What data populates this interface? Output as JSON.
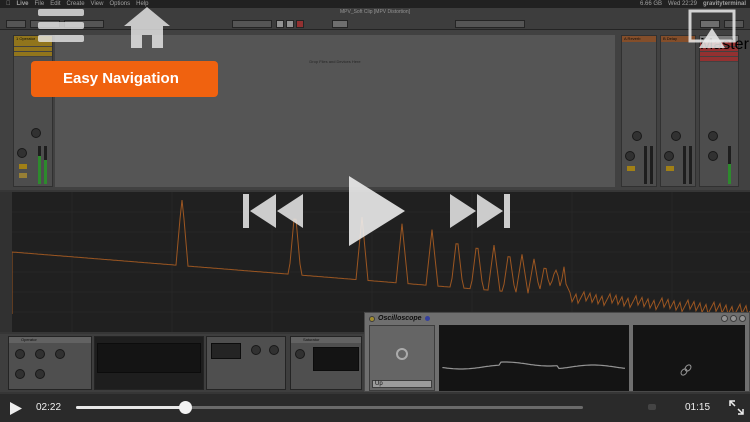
{
  "menubar": {
    "app": "Live",
    "items": [
      "File",
      "Edit",
      "Create",
      "View",
      "Options",
      "Help"
    ],
    "disk": "6.66 GB",
    "clock": "Wed 22:29",
    "user": "gravityterminal"
  },
  "window": {
    "title": "MPV_Soft Clip [MPV Distortion]",
    "drop_hint": "Drop Files and Devices Here"
  },
  "tracks": {
    "left": "1 Operator",
    "return_a": "A Reverb",
    "return_b": "B Delay",
    "master": "Master"
  },
  "devices": {
    "operator": "Operator",
    "saturator": "Saturator"
  },
  "oscilloscope": {
    "title": "Oscilloscope",
    "mode": "Up"
  },
  "overlay": {
    "easy_nav_label": "Easy Navigation"
  },
  "player": {
    "elapsed": "02:22",
    "remaining": "01:15",
    "progress_pct": 21.5
  },
  "colors": {
    "accent_orange": "#f0620f",
    "spectrum_line": "#d9782f",
    "scope_line": "#cfcfcf"
  }
}
